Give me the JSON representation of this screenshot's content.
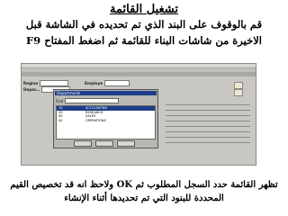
{
  "slide": {
    "title": "تشغيل القائمة",
    "instruction_line1": "قم بالوقوف على البند الذي تم تحديده في الشاشة قبل",
    "instruction_line2": "الاخيرة من شاشات البناء للقائمة ثم اضغط المفتاح F9",
    "footer_line1": "تظهر القائمة حدد السجل المطلوب ثم  OK  ولاحظ انه قد تخصيص القيم",
    "footer_line2": "المحددة للبنود التي تم تحديدها أثناء الإنشاء"
  },
  "form": {
    "region_label": "Region",
    "employee_label": "Employe",
    "department_label": "Depar..."
  },
  "lov": {
    "title": "Departments",
    "find_label": "Find",
    "rows": [
      {
        "code": "10",
        "name": "ACCOUNTING"
      },
      {
        "code": "20",
        "name": "RESEARCH"
      },
      {
        "code": "30",
        "name": "SALES"
      },
      {
        "code": "40",
        "name": "OPERATIONS"
      }
    ],
    "selected_index": 0
  }
}
